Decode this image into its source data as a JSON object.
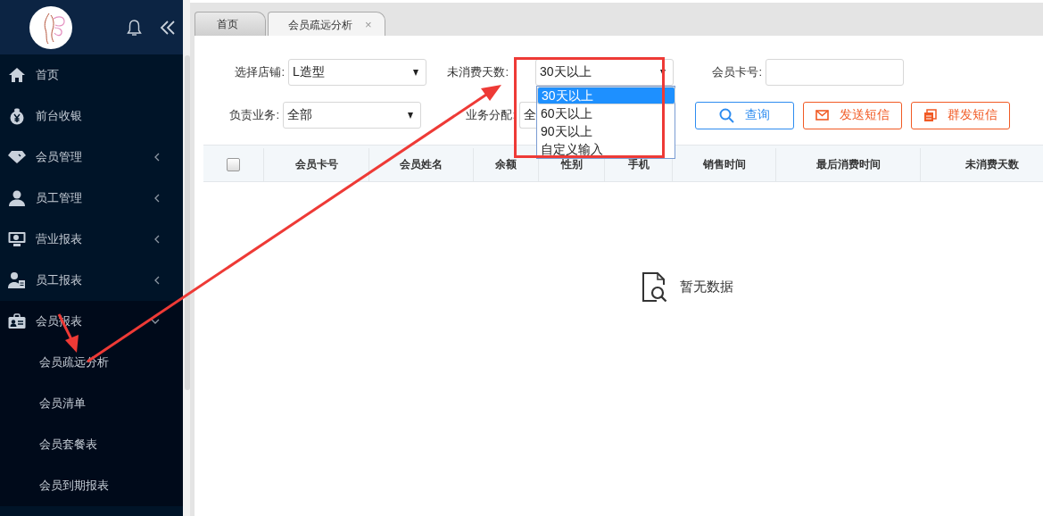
{
  "sidebar": {
    "items": [
      {
        "label": "首页",
        "kind": "home"
      },
      {
        "label": "前台收银",
        "kind": "money"
      },
      {
        "label": "会员管理",
        "kind": "tag",
        "expanded": false
      },
      {
        "label": "员工管理",
        "kind": "user",
        "expanded": false
      },
      {
        "label": "营业报表",
        "kind": "monitor",
        "expanded": false
      },
      {
        "label": "员工报表",
        "kind": "user-doc",
        "expanded": false
      },
      {
        "label": "会员报表",
        "kind": "id-card",
        "expanded": true,
        "children": [
          {
            "label": "会员疏远分析"
          },
          {
            "label": "会员清单"
          },
          {
            "label": "会员套餐表"
          },
          {
            "label": "会员到期报表"
          }
        ]
      }
    ]
  },
  "tabs": [
    {
      "label": "首页",
      "selected": false
    },
    {
      "label": "会员疏远分析",
      "selected": true,
      "close": "×"
    }
  ],
  "filters": [
    {
      "kind": "select",
      "label": "选择店铺:",
      "value": "L造型"
    },
    {
      "kind": "select",
      "label": "未消费天数:",
      "value": "30天以上",
      "options": [
        {
          "label": "30天以上",
          "selected": true
        },
        {
          "label": "60天以上",
          "selected": false
        },
        {
          "label": "90天以上",
          "selected": false
        },
        {
          "label": "自定义输入",
          "selected": false
        }
      ]
    },
    {
      "kind": "input",
      "label": "会员卡号:"
    },
    {
      "kind": "select",
      "label": "负责业务:",
      "value": "全部"
    },
    {
      "kind": "select",
      "label": "业务分配:",
      "value": "全"
    }
  ],
  "buttons": [
    {
      "label": "查询",
      "kind": "search"
    },
    {
      "label": "发送短信",
      "kind": "sms"
    },
    {
      "label": "群发短信",
      "kind": "bulk-sms"
    }
  ],
  "table": {
    "select_all": {
      "checked": false
    },
    "columns": [
      "会员卡号",
      "会员姓名",
      "余额",
      "性别",
      "手机",
      "销售时间",
      "最后消费时间",
      "未消费天数"
    ],
    "empty_text": "暂无数据"
  }
}
